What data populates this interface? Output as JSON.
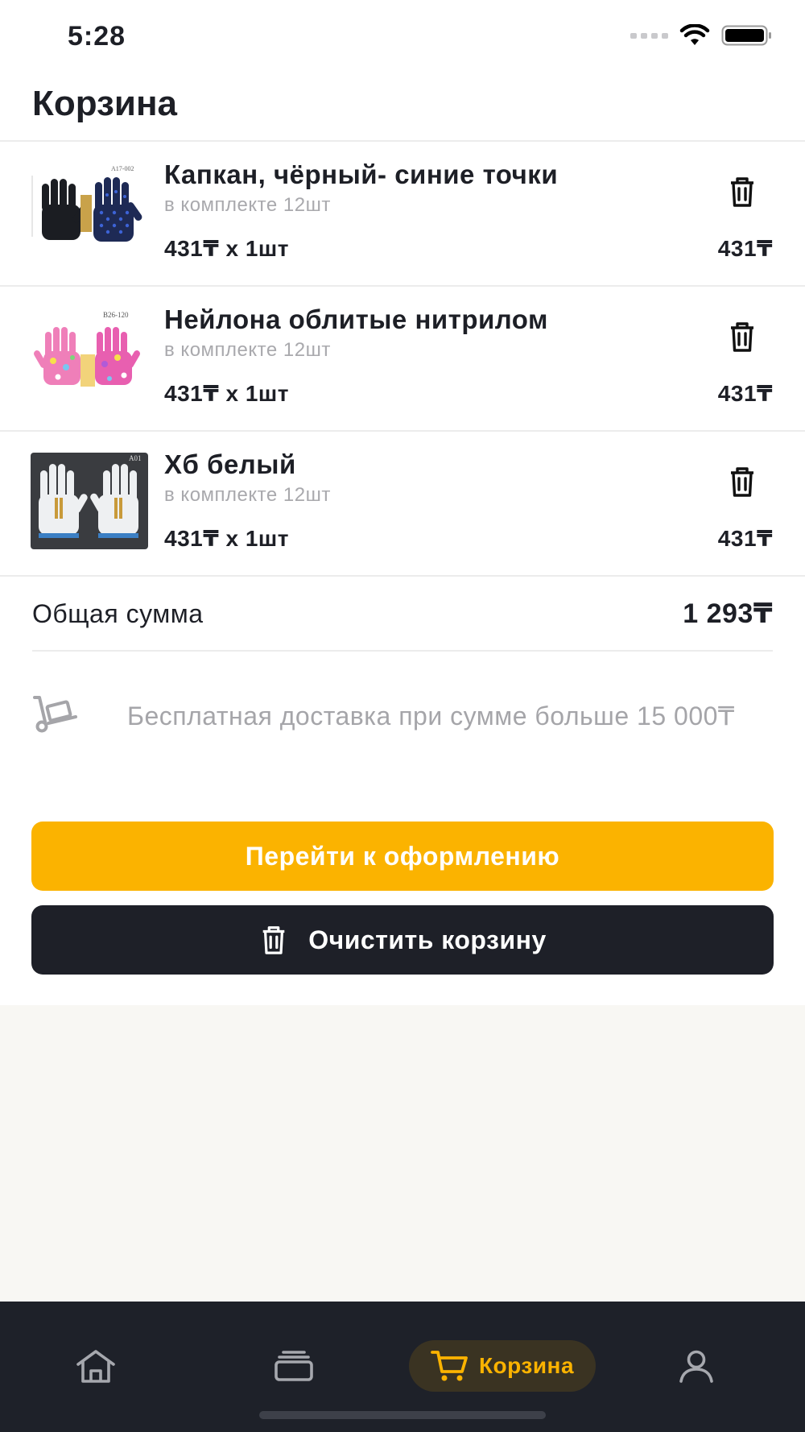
{
  "status_bar": {
    "time": "5:28"
  },
  "header": {
    "title": "Корзина"
  },
  "cart": {
    "items": [
      {
        "name": "Капкан, чёрный- синие точки",
        "pack": "в комплекте 12шт",
        "qty_price": "431₸ x 1шт",
        "total": "431₸",
        "image_code": "A17-002"
      },
      {
        "name": "Нейлона облитые нитрилом",
        "pack": "в комплекте 12шт",
        "qty_price": "431₸ x 1шт",
        "total": "431₸",
        "image_code": "B26-120"
      },
      {
        "name": "Хб белый",
        "pack": "в комплекте 12шт",
        "qty_price": "431₸ x 1шт",
        "total": "431₸",
        "image_code": "A01"
      }
    ],
    "total_label": "Общая сумма",
    "total_value": "1 293₸",
    "delivery_note": "Бесплатная доставка при сумме больше 15 000₸"
  },
  "actions": {
    "checkout_label": "Перейти к оформлению",
    "clear_label": "Очистить корзину"
  },
  "bottom_nav": {
    "items": [
      {
        "icon": "home-icon",
        "label": ""
      },
      {
        "icon": "catalog-icon",
        "label": ""
      },
      {
        "icon": "cart-icon",
        "label": "Корзина",
        "active": true
      },
      {
        "icon": "profile-icon",
        "label": ""
      }
    ]
  },
  "colors": {
    "accent": "#fbb300",
    "dark": "#1e2028",
    "muted_text": "#a5a5a9",
    "background": "#f8f7f3"
  }
}
